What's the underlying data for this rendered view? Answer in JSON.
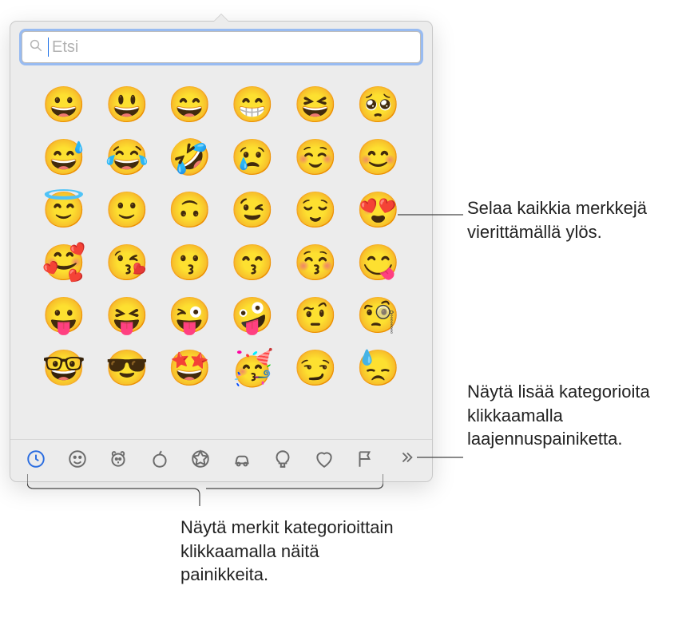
{
  "search": {
    "placeholder": "Etsi",
    "value": ""
  },
  "emojis": [
    "😀",
    "😃",
    "😄",
    "😁",
    "😆",
    "🥺",
    "😅",
    "😂",
    "🤣",
    "😢",
    "☺️",
    "😊",
    "😇",
    "🙂",
    "🙃",
    "😉",
    "😌",
    "😍",
    "🥰",
    "😘",
    "😗",
    "😙",
    "😚",
    "😋",
    "😛",
    "😝",
    "😜",
    "🤪",
    "🤨",
    "🧐",
    "🤓",
    "😎",
    "🤩",
    "🥳",
    "😏",
    "😓"
  ],
  "categories": [
    {
      "id": "recent",
      "active": true
    },
    {
      "id": "smileys",
      "active": false
    },
    {
      "id": "animals",
      "active": false
    },
    {
      "id": "food",
      "active": false
    },
    {
      "id": "activity",
      "active": false
    },
    {
      "id": "travel",
      "active": false
    },
    {
      "id": "objects",
      "active": false
    },
    {
      "id": "symbols",
      "active": false
    },
    {
      "id": "flags",
      "active": false
    }
  ],
  "callouts": {
    "scroll": "Selaa kaikkia merkkejä vierittämällä ylös.",
    "expand": "Näytä lisää kategorioita klikkaamalla laajennuspainiketta.",
    "cats": "Näytä merkit kategorioittain klikkaamalla näitä painikkeita."
  }
}
